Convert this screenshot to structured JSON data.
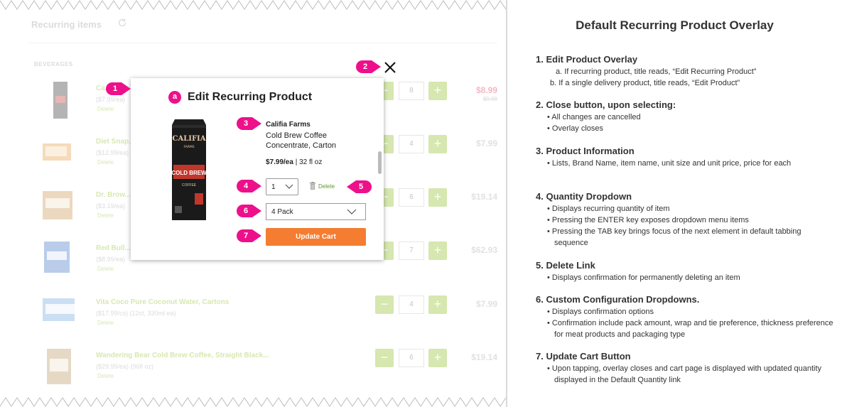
{
  "mockup": {
    "section_title": "Recurring items",
    "category": "BEVERAGES",
    "rows": [
      {
        "name": "Ca...",
        "price": "($7.99/ea)",
        "delete": "Delete",
        "qty": "8",
        "total": "$8.99",
        "strike": "$9.99"
      },
      {
        "name": "Diet Snap...",
        "price": "($12.99/ea)",
        "delete": "Delete",
        "qty": "4",
        "total": "$7.99",
        "strike": ""
      },
      {
        "name": "Dr. Brow...",
        "price": "($3.19/ea)",
        "delete": "Delete",
        "qty": "6",
        "total": "$19.14",
        "strike": ""
      },
      {
        "name": "Red Bull...",
        "price": "($8.99/ea)",
        "delete": "Delete",
        "qty": "7",
        "total": "$62.93",
        "strike": ""
      },
      {
        "name": "Vita Coco Pure Coconut Water, Cartons",
        "price": "($17.99/cs) (12ct, 330ml ea)",
        "delete": "Delete",
        "qty": "4",
        "total": "$7.99",
        "strike": ""
      },
      {
        "name": "Wandering Bear Cold Brew Coffee, Straight Black...",
        "price": "($29.99/ea) (96fl oz)",
        "delete": "Delete",
        "qty": "6",
        "total": "$19.14",
        "strike": ""
      }
    ],
    "qty_minus": "−",
    "qty_plus": "+"
  },
  "modal": {
    "title": "Edit Recurring Product",
    "brand": "Califia Farms",
    "name": "Cold Brew Coffee Concentrate, Carton",
    "price": "$7.99/ea",
    "size": " | 32 fl oz",
    "qty_value": "1",
    "delete_label": "Delete",
    "pack_value": "4 Pack",
    "update_label": "Update Cart",
    "carton_brand": "CALIFIA",
    "carton_brand2": "FARMS",
    "carton_label": "COLD BREW",
    "carton_sub": "COFFEE"
  },
  "callouts": {
    "one": "1",
    "two": "2",
    "three": "3",
    "four": "4",
    "five": "5",
    "six": "6",
    "seven": "7",
    "a": "a"
  },
  "notes": {
    "title": "Default Recurring Product Overlay",
    "sections": [
      {
        "heading": "1. Edit Product Overlay",
        "lines": [
          "a. If recurring product, title reads, “Edit Recurring Product”",
          "b. If a single delivery product, title reads, “Edit Product”"
        ]
      },
      {
        "heading": "2. Close button, upon selecting:",
        "lines": [
          "• All changes are cancelled",
          "• Overlay closes"
        ]
      },
      {
        "heading": "3. Product Information",
        "lines": [
          "• Lists, Brand Name, item name, unit size and unit price, price for each"
        ]
      },
      {
        "heading": "4. Quantity Dropdown",
        "lines": [
          "• Displays recurring quantity of item",
          "• Pressing the ENTER key exposes dropdown menu items",
          "• Pressing the TAB key brings focus of the next element in default tabbing sequence"
        ]
      },
      {
        "heading": "5.  Delete Link",
        "lines": [
          "• Displays confirmation for permanently deleting an item"
        ]
      },
      {
        "heading": "6. Custom Configuration Dropdowns.",
        "lines": [
          "• Displays confirmation options",
          "• Confirmation include pack amount, wrap and tie preference, thickness preference for meat products and packaging type"
        ]
      },
      {
        "heading": "7. Update Cart Button",
        "lines": [
          "• Upon tapping, overlay closes and cart page is displayed with updated quantity displayed in the Default Quantity link"
        ]
      }
    ]
  },
  "colors": {
    "accent_green": "#8dbb1e",
    "callout_pink": "#ee108a",
    "update_orange": "#f47d31",
    "sale_red": "#d9344d"
  }
}
